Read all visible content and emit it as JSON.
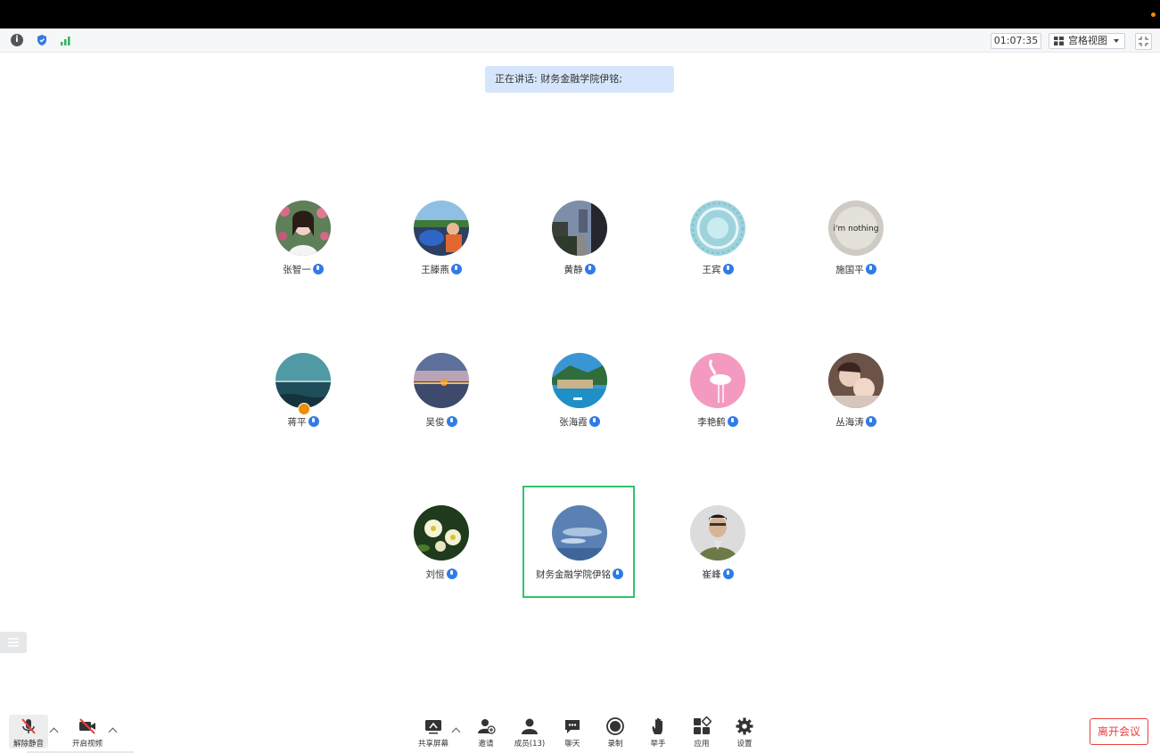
{
  "status_bar": {
    "timer": "01:07:35",
    "view_mode": "宫格视图"
  },
  "speaking_banner": "正在讲话: 财务金融学院伊铭;",
  "participants": [
    {
      "name": "张智一",
      "avatar": "woman-with-flowers-photo"
    },
    {
      "name": "王滕燕",
      "avatar": "child-in-car-photo"
    },
    {
      "name": "黄静",
      "avatar": "dusk-street-photo"
    },
    {
      "name": "王宾",
      "avatar": "teal-pattern-image"
    },
    {
      "name": "施国平",
      "avatar": "im-nothing-text-image",
      "avatar_text": "i'm nothing"
    },
    {
      "name": "蒋平",
      "avatar": "sea-horizon-photo",
      "host": true
    },
    {
      "name": "吴俊",
      "avatar": "sunset-sea-photo"
    },
    {
      "name": "张海霞",
      "avatar": "coastal-town-photo"
    },
    {
      "name": "李艳鹤",
      "avatar": "pink-flamingo-image"
    },
    {
      "name": "丛海涛",
      "avatar": "child-portrait-photo"
    },
    {
      "name": "刘恒",
      "avatar": "white-flowers-photo"
    },
    {
      "name": "财务金融学院伊铭",
      "avatar": "blue-sky-photo",
      "active_speaker": true
    },
    {
      "name": "崔峰",
      "avatar": "uniform-portrait-photo"
    }
  ],
  "toolbar": {
    "unmute": "解除静音",
    "start_video": "开启视频",
    "share_screen": "共享屏幕",
    "invite": "邀请",
    "members": "成员(13)",
    "chat": "聊天",
    "record": "录制",
    "raise_hand": "举手",
    "apps": "应用",
    "settings": "设置",
    "leave": "离开会议"
  },
  "colors": {
    "accent_blue": "#2f7be8",
    "active_speaker_border": "#32c36c",
    "leave_red": "#e8403c",
    "speaking_banner_bg": "#d5e5fb"
  }
}
